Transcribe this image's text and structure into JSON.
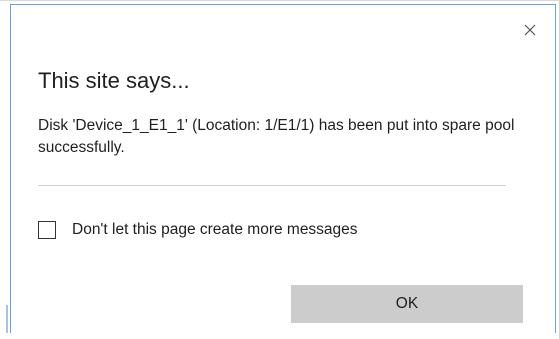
{
  "dialog": {
    "close_icon": "close-icon",
    "title": "This site says...",
    "message": "Disk 'Device_1_E1_1' (Location: 1/E1/1) has been put into spare pool successfully.",
    "checkbox_label": "Don't let this page create more messages",
    "checkbox_checked": false,
    "ok_label": "OK"
  },
  "colors": {
    "border_accent": "#6f9fd8",
    "button_bg": "#cccccc",
    "text": "#1f1f1f"
  }
}
